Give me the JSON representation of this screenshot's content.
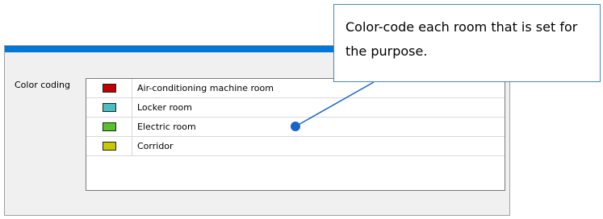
{
  "panel": {
    "label": "Color coding"
  },
  "rooms": [
    {
      "name": "Air-conditioning machine room",
      "color": "#c00000"
    },
    {
      "name": "Locker room",
      "color": "#4bbdc2"
    },
    {
      "name": "Electric room",
      "color": "#59c22a"
    },
    {
      "name": "Corridor",
      "color": "#c8c800"
    }
  ],
  "callout": {
    "text": "Color-code each room that is set for the purpose."
  },
  "colors": {
    "title_bar": "#0078d7",
    "callout_border": "#4a86c5",
    "leader_dot": "#1a64c8"
  }
}
